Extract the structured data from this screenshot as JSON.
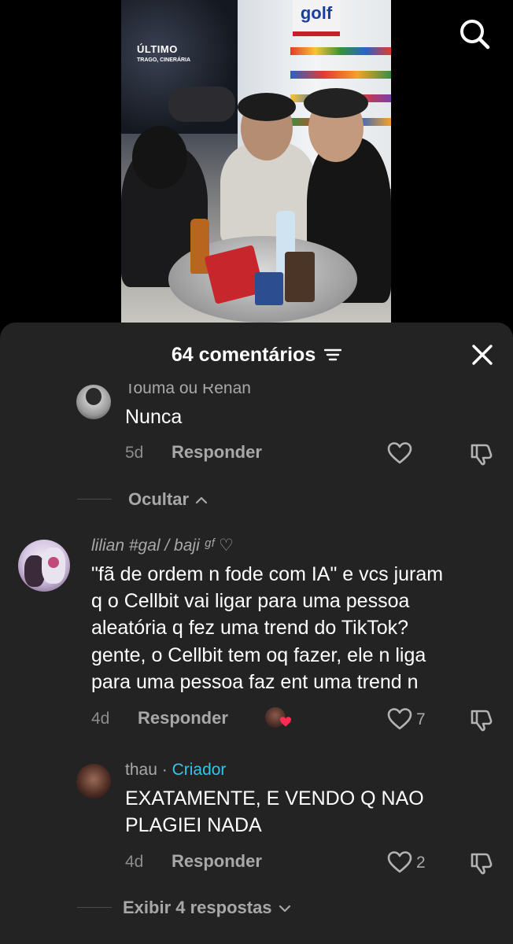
{
  "video": {
    "logo_line1": "ÚLTIMO",
    "logo_line2": "TRAGO, CINERÁRIA",
    "store_sign": "golf"
  },
  "icons": {
    "search": "search-icon",
    "filter": "filter-icon",
    "close": "close-icon",
    "heart": "heart-icon",
    "dislike": "thumbs-down-icon",
    "chevron_up": "chevron-up-icon",
    "chevron_down": "chevron-down-icon"
  },
  "colors": {
    "sheet_bg": "#232323",
    "creator": "#33c5e8",
    "muted": "#a8a8a8"
  },
  "sheet": {
    "title": "64 comentários"
  },
  "comments": [
    {
      "username": "Touma ou Renan",
      "text": [
        "Nunca"
      ],
      "date": "5d",
      "reply_label": "Responder",
      "likes": ""
    },
    {
      "username": "lilian #gal / baji ᵍᶠ ♡",
      "text": [
        "\"fã de ordem n fode com IA\" e vcs juram",
        "q o Cellbit vai ligar para uma pessoa",
        "aleatória q fez uma trend do TikTok?",
        "gente, o Cellbit tem oq fazer, ele n liga",
        "para uma pessoa faz ent uma trend n"
      ],
      "date": "4d",
      "reply_label": "Responder",
      "likes": "7"
    }
  ],
  "hide_label": "Ocultar",
  "reply": {
    "username": "thau",
    "separator": "·",
    "badge": "Criador",
    "text": [
      "EXATAMENTE, E VENDO Q NAO",
      "PLAGIEI NADA"
    ],
    "date": "4d",
    "reply_label": "Responder",
    "likes": "2"
  },
  "show_more_label": "Exibir 4 respostas"
}
